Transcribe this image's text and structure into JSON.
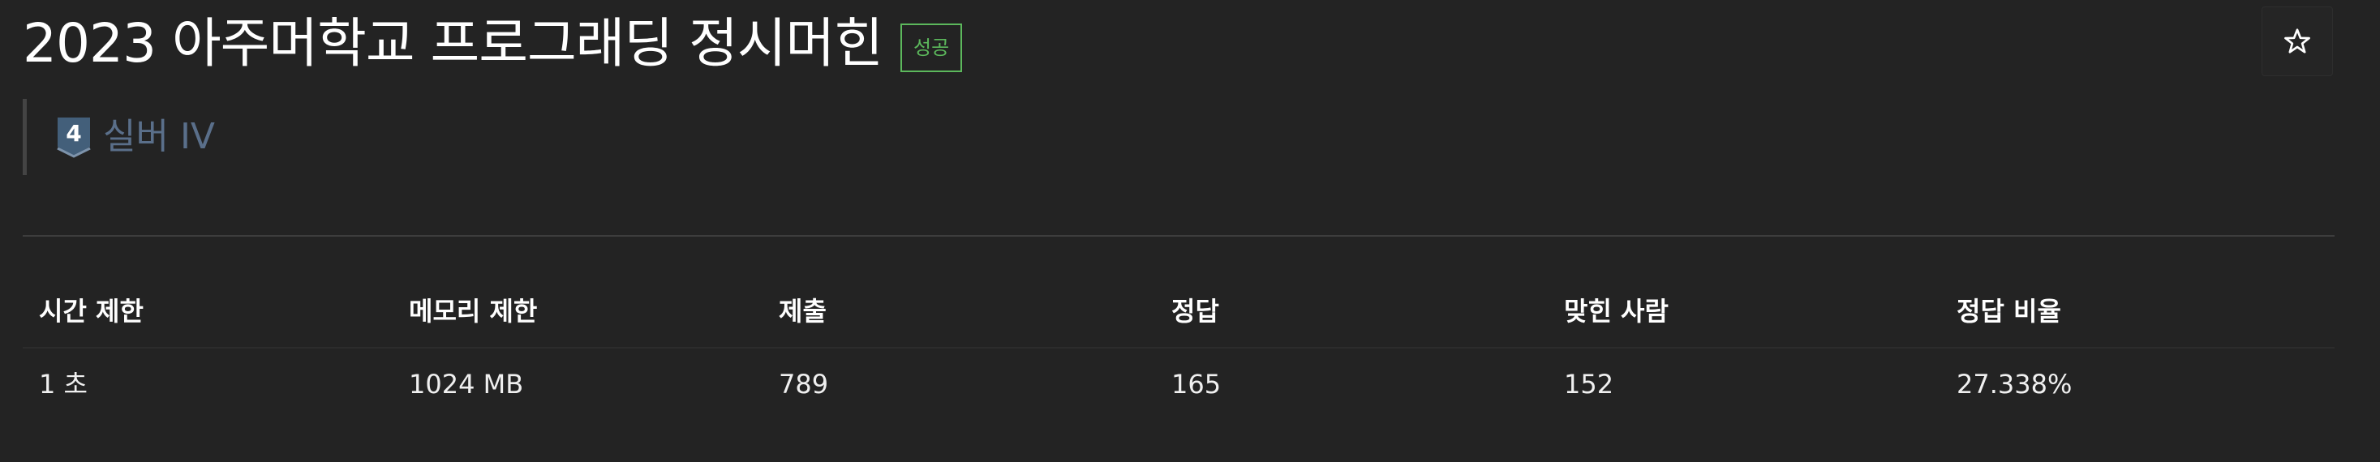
{
  "problem": {
    "title": "2023 아주머학교 프로그래딩 정시머힌",
    "status_badge": "성공"
  },
  "tier": {
    "number": "4",
    "label": "실버 IV",
    "color": "#5a6f8a"
  },
  "stats": {
    "headers": [
      "시간 제한",
      "메모리 제한",
      "제출",
      "정답",
      "맞힌 사람",
      "정답 비율"
    ],
    "values": [
      "1 초",
      "1024 MB",
      "789",
      "165",
      "152",
      "27.338%"
    ]
  },
  "icons": {
    "star": "star-outline-icon",
    "tier": "silver-tier-icon"
  },
  "colors": {
    "background": "#232323",
    "success": "#5cb85c",
    "tier_silver": "#5a6f8a"
  }
}
